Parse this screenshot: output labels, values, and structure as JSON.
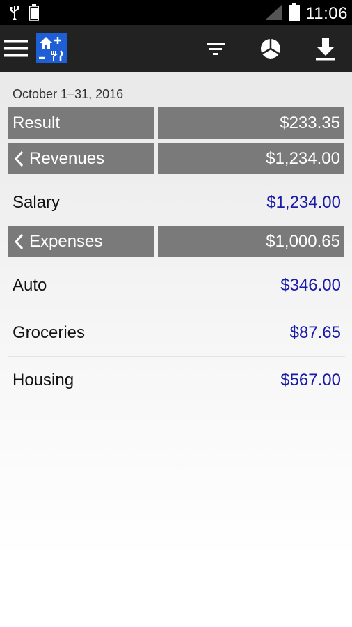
{
  "status_bar": {
    "time": "11:06",
    "icons": [
      "usb-icon",
      "battery-small-icon",
      "signal-icon",
      "battery-icon"
    ]
  },
  "toolbar": {
    "icons": [
      "menu-icon",
      "app-logo-icon",
      "filter-icon",
      "pie-chart-icon",
      "download-icon"
    ]
  },
  "period": "October 1–31, 2016",
  "result": {
    "label": "Result",
    "value": "$233.35"
  },
  "revenues": {
    "label": "Revenues",
    "value": "$1,234.00",
    "items": [
      {
        "name": "Salary",
        "amount": "$1,234.00"
      }
    ]
  },
  "expenses": {
    "label": "Expenses",
    "value": "$1,000.65",
    "items": [
      {
        "name": "Auto",
        "amount": "$346.00"
      },
      {
        "name": "Groceries",
        "amount": "$87.65"
      },
      {
        "name": "Housing",
        "amount": "$567.00"
      }
    ]
  },
  "colors": {
    "bar_bg": "#7a7a7a",
    "amount": "#1a1aaa",
    "toolbar": "#222222",
    "logo": "#1f5fd6"
  }
}
